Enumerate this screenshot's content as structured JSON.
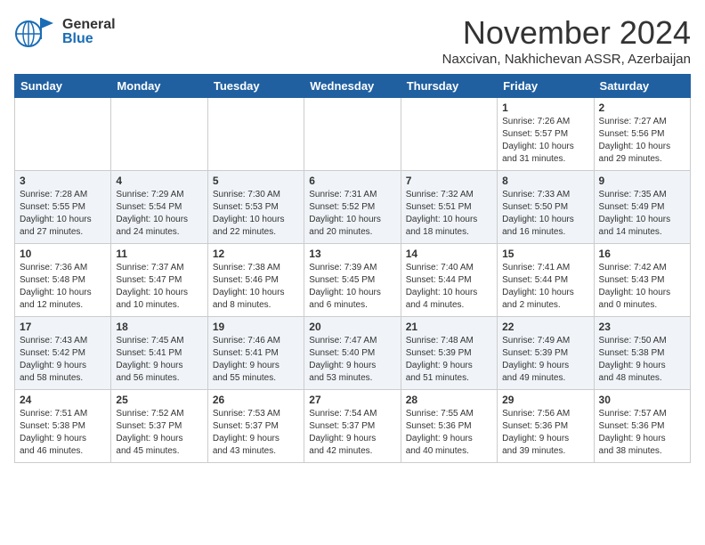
{
  "header": {
    "logo_general": "General",
    "logo_blue": "Blue",
    "month_title": "November 2024",
    "location": "Naxcivan, Nakhichevan ASSR, Azerbaijan"
  },
  "weekdays": [
    "Sunday",
    "Monday",
    "Tuesday",
    "Wednesday",
    "Thursday",
    "Friday",
    "Saturday"
  ],
  "weeks": [
    [
      {
        "day": "",
        "info": ""
      },
      {
        "day": "",
        "info": ""
      },
      {
        "day": "",
        "info": ""
      },
      {
        "day": "",
        "info": ""
      },
      {
        "day": "",
        "info": ""
      },
      {
        "day": "1",
        "info": "Sunrise: 7:26 AM\nSunset: 5:57 PM\nDaylight: 10 hours\nand 31 minutes."
      },
      {
        "day": "2",
        "info": "Sunrise: 7:27 AM\nSunset: 5:56 PM\nDaylight: 10 hours\nand 29 minutes."
      }
    ],
    [
      {
        "day": "3",
        "info": "Sunrise: 7:28 AM\nSunset: 5:55 PM\nDaylight: 10 hours\nand 27 minutes."
      },
      {
        "day": "4",
        "info": "Sunrise: 7:29 AM\nSunset: 5:54 PM\nDaylight: 10 hours\nand 24 minutes."
      },
      {
        "day": "5",
        "info": "Sunrise: 7:30 AM\nSunset: 5:53 PM\nDaylight: 10 hours\nand 22 minutes."
      },
      {
        "day": "6",
        "info": "Sunrise: 7:31 AM\nSunset: 5:52 PM\nDaylight: 10 hours\nand 20 minutes."
      },
      {
        "day": "7",
        "info": "Sunrise: 7:32 AM\nSunset: 5:51 PM\nDaylight: 10 hours\nand 18 minutes."
      },
      {
        "day": "8",
        "info": "Sunrise: 7:33 AM\nSunset: 5:50 PM\nDaylight: 10 hours\nand 16 minutes."
      },
      {
        "day": "9",
        "info": "Sunrise: 7:35 AM\nSunset: 5:49 PM\nDaylight: 10 hours\nand 14 minutes."
      }
    ],
    [
      {
        "day": "10",
        "info": "Sunrise: 7:36 AM\nSunset: 5:48 PM\nDaylight: 10 hours\nand 12 minutes."
      },
      {
        "day": "11",
        "info": "Sunrise: 7:37 AM\nSunset: 5:47 PM\nDaylight: 10 hours\nand 10 minutes."
      },
      {
        "day": "12",
        "info": "Sunrise: 7:38 AM\nSunset: 5:46 PM\nDaylight: 10 hours\nand 8 minutes."
      },
      {
        "day": "13",
        "info": "Sunrise: 7:39 AM\nSunset: 5:45 PM\nDaylight: 10 hours\nand 6 minutes."
      },
      {
        "day": "14",
        "info": "Sunrise: 7:40 AM\nSunset: 5:44 PM\nDaylight: 10 hours\nand 4 minutes."
      },
      {
        "day": "15",
        "info": "Sunrise: 7:41 AM\nSunset: 5:44 PM\nDaylight: 10 hours\nand 2 minutes."
      },
      {
        "day": "16",
        "info": "Sunrise: 7:42 AM\nSunset: 5:43 PM\nDaylight: 10 hours\nand 0 minutes."
      }
    ],
    [
      {
        "day": "17",
        "info": "Sunrise: 7:43 AM\nSunset: 5:42 PM\nDaylight: 9 hours\nand 58 minutes."
      },
      {
        "day": "18",
        "info": "Sunrise: 7:45 AM\nSunset: 5:41 PM\nDaylight: 9 hours\nand 56 minutes."
      },
      {
        "day": "19",
        "info": "Sunrise: 7:46 AM\nSunset: 5:41 PM\nDaylight: 9 hours\nand 55 minutes."
      },
      {
        "day": "20",
        "info": "Sunrise: 7:47 AM\nSunset: 5:40 PM\nDaylight: 9 hours\nand 53 minutes."
      },
      {
        "day": "21",
        "info": "Sunrise: 7:48 AM\nSunset: 5:39 PM\nDaylight: 9 hours\nand 51 minutes."
      },
      {
        "day": "22",
        "info": "Sunrise: 7:49 AM\nSunset: 5:39 PM\nDaylight: 9 hours\nand 49 minutes."
      },
      {
        "day": "23",
        "info": "Sunrise: 7:50 AM\nSunset: 5:38 PM\nDaylight: 9 hours\nand 48 minutes."
      }
    ],
    [
      {
        "day": "24",
        "info": "Sunrise: 7:51 AM\nSunset: 5:38 PM\nDaylight: 9 hours\nand 46 minutes."
      },
      {
        "day": "25",
        "info": "Sunrise: 7:52 AM\nSunset: 5:37 PM\nDaylight: 9 hours\nand 45 minutes."
      },
      {
        "day": "26",
        "info": "Sunrise: 7:53 AM\nSunset: 5:37 PM\nDaylight: 9 hours\nand 43 minutes."
      },
      {
        "day": "27",
        "info": "Sunrise: 7:54 AM\nSunset: 5:37 PM\nDaylight: 9 hours\nand 42 minutes."
      },
      {
        "day": "28",
        "info": "Sunrise: 7:55 AM\nSunset: 5:36 PM\nDaylight: 9 hours\nand 40 minutes."
      },
      {
        "day": "29",
        "info": "Sunrise: 7:56 AM\nSunset: 5:36 PM\nDaylight: 9 hours\nand 39 minutes."
      },
      {
        "day": "30",
        "info": "Sunrise: 7:57 AM\nSunset: 5:36 PM\nDaylight: 9 hours\nand 38 minutes."
      }
    ]
  ]
}
